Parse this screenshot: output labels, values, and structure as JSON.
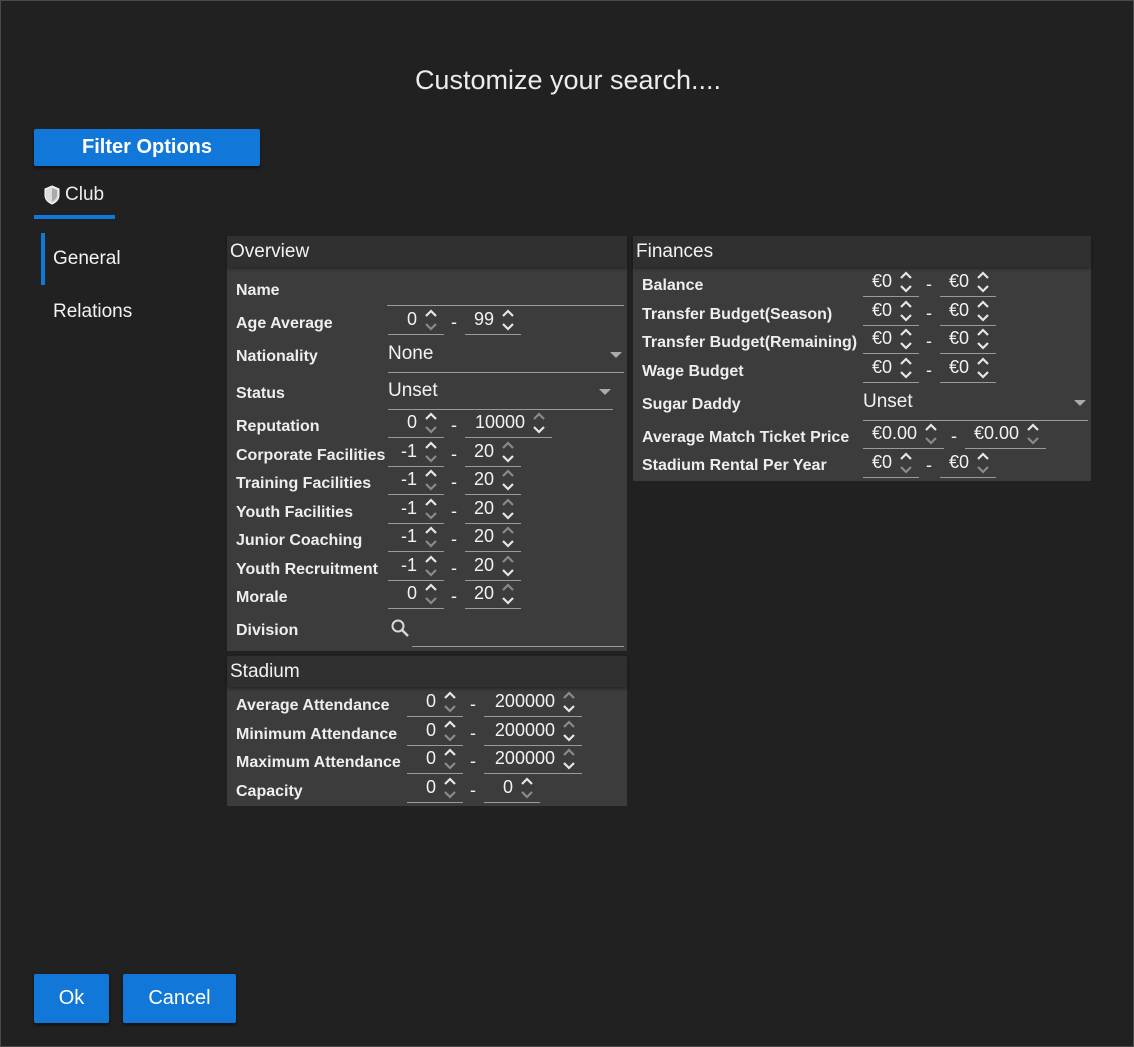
{
  "dialog": {
    "title": "Customize your search...."
  },
  "filter_options_label": "Filter Options",
  "tabs": {
    "club": "Club"
  },
  "sidebar": {
    "items": [
      {
        "label": "General"
      },
      {
        "label": "Relations"
      }
    ]
  },
  "overview": {
    "title": "Overview",
    "name": {
      "label": "Name",
      "value": ""
    },
    "age_average": {
      "label": "Age Average",
      "min": "0",
      "max": "99"
    },
    "nationality": {
      "label": "Nationality",
      "value": "None"
    },
    "status": {
      "label": "Status",
      "value": "Unset"
    },
    "reputation": {
      "label": "Reputation",
      "min": "0",
      "max": "10000"
    },
    "corporate_facilities": {
      "label": "Corporate Facilities",
      "min": "-1",
      "max": "20"
    },
    "training_facilities": {
      "label": "Training Facilities",
      "min": "-1",
      "max": "20"
    },
    "youth_facilities": {
      "label": "Youth Facilities",
      "min": "-1",
      "max": "20"
    },
    "junior_coaching": {
      "label": "Junior Coaching",
      "min": "-1",
      "max": "20"
    },
    "youth_recruitment": {
      "label": "Youth Recruitment",
      "min": "-1",
      "max": "20"
    },
    "morale": {
      "label": "Morale",
      "min": "0",
      "max": "20"
    },
    "division": {
      "label": "Division",
      "value": ""
    }
  },
  "stadium": {
    "title": "Stadium",
    "average_attendance": {
      "label": "Average Attendance",
      "min": "0",
      "max": "200000"
    },
    "minimum_attendance": {
      "label": "Minimum Attendance",
      "min": "0",
      "max": "200000"
    },
    "maximum_attendance": {
      "label": "Maximum Attendance",
      "min": "0",
      "max": "200000"
    },
    "capacity": {
      "label": "Capacity",
      "min": "0",
      "max": "0"
    }
  },
  "finances": {
    "title": "Finances",
    "balance": {
      "label": "Balance",
      "min": "€0",
      "max": "€0"
    },
    "transfer_budget_season": {
      "label": "Transfer Budget(Season)",
      "min": "€0",
      "max": "€0"
    },
    "transfer_budget_remaining": {
      "label": "Transfer Budget(Remaining)",
      "min": "€0",
      "max": "€0"
    },
    "wage_budget": {
      "label": "Wage Budget",
      "min": "€0",
      "max": "€0"
    },
    "sugar_daddy": {
      "label": "Sugar Daddy",
      "value": "Unset"
    },
    "average_match_ticket_price": {
      "label": "Average Match Ticket Price",
      "min": "€0.00",
      "max": "€0.00"
    },
    "stadium_rental_per_year": {
      "label": "Stadium Rental Per Year",
      "min": "€0",
      "max": "€0"
    }
  },
  "buttons": {
    "ok": "Ok",
    "cancel": "Cancel"
  },
  "colors": {
    "accent": "#1177d8",
    "background": "#212121",
    "panel": "#3c3c3c",
    "panel_header": "#303030"
  }
}
